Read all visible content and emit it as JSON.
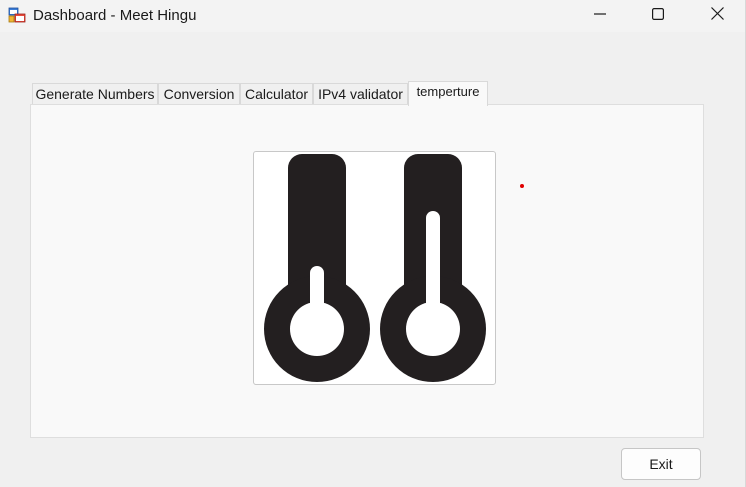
{
  "window": {
    "title": "Dashboard - Meet Hingu",
    "icon": "app-forms-icon",
    "controls": {
      "minimize_icon": "minimize-icon",
      "maximize_icon": "maximize-icon",
      "close_icon": "close-icon"
    }
  },
  "tabs": [
    {
      "label": "Generate Numbers",
      "active": false
    },
    {
      "label": "Conversion",
      "active": false
    },
    {
      "label": "Calculator",
      "active": false
    },
    {
      "label": "IPv4 validator",
      "active": false
    },
    {
      "label": "temperture",
      "active": true
    }
  ],
  "tab_page": {
    "image_icon": "thermometers-icon",
    "marker_color": "#e00000"
  },
  "footer": {
    "exit_label": "Exit"
  }
}
